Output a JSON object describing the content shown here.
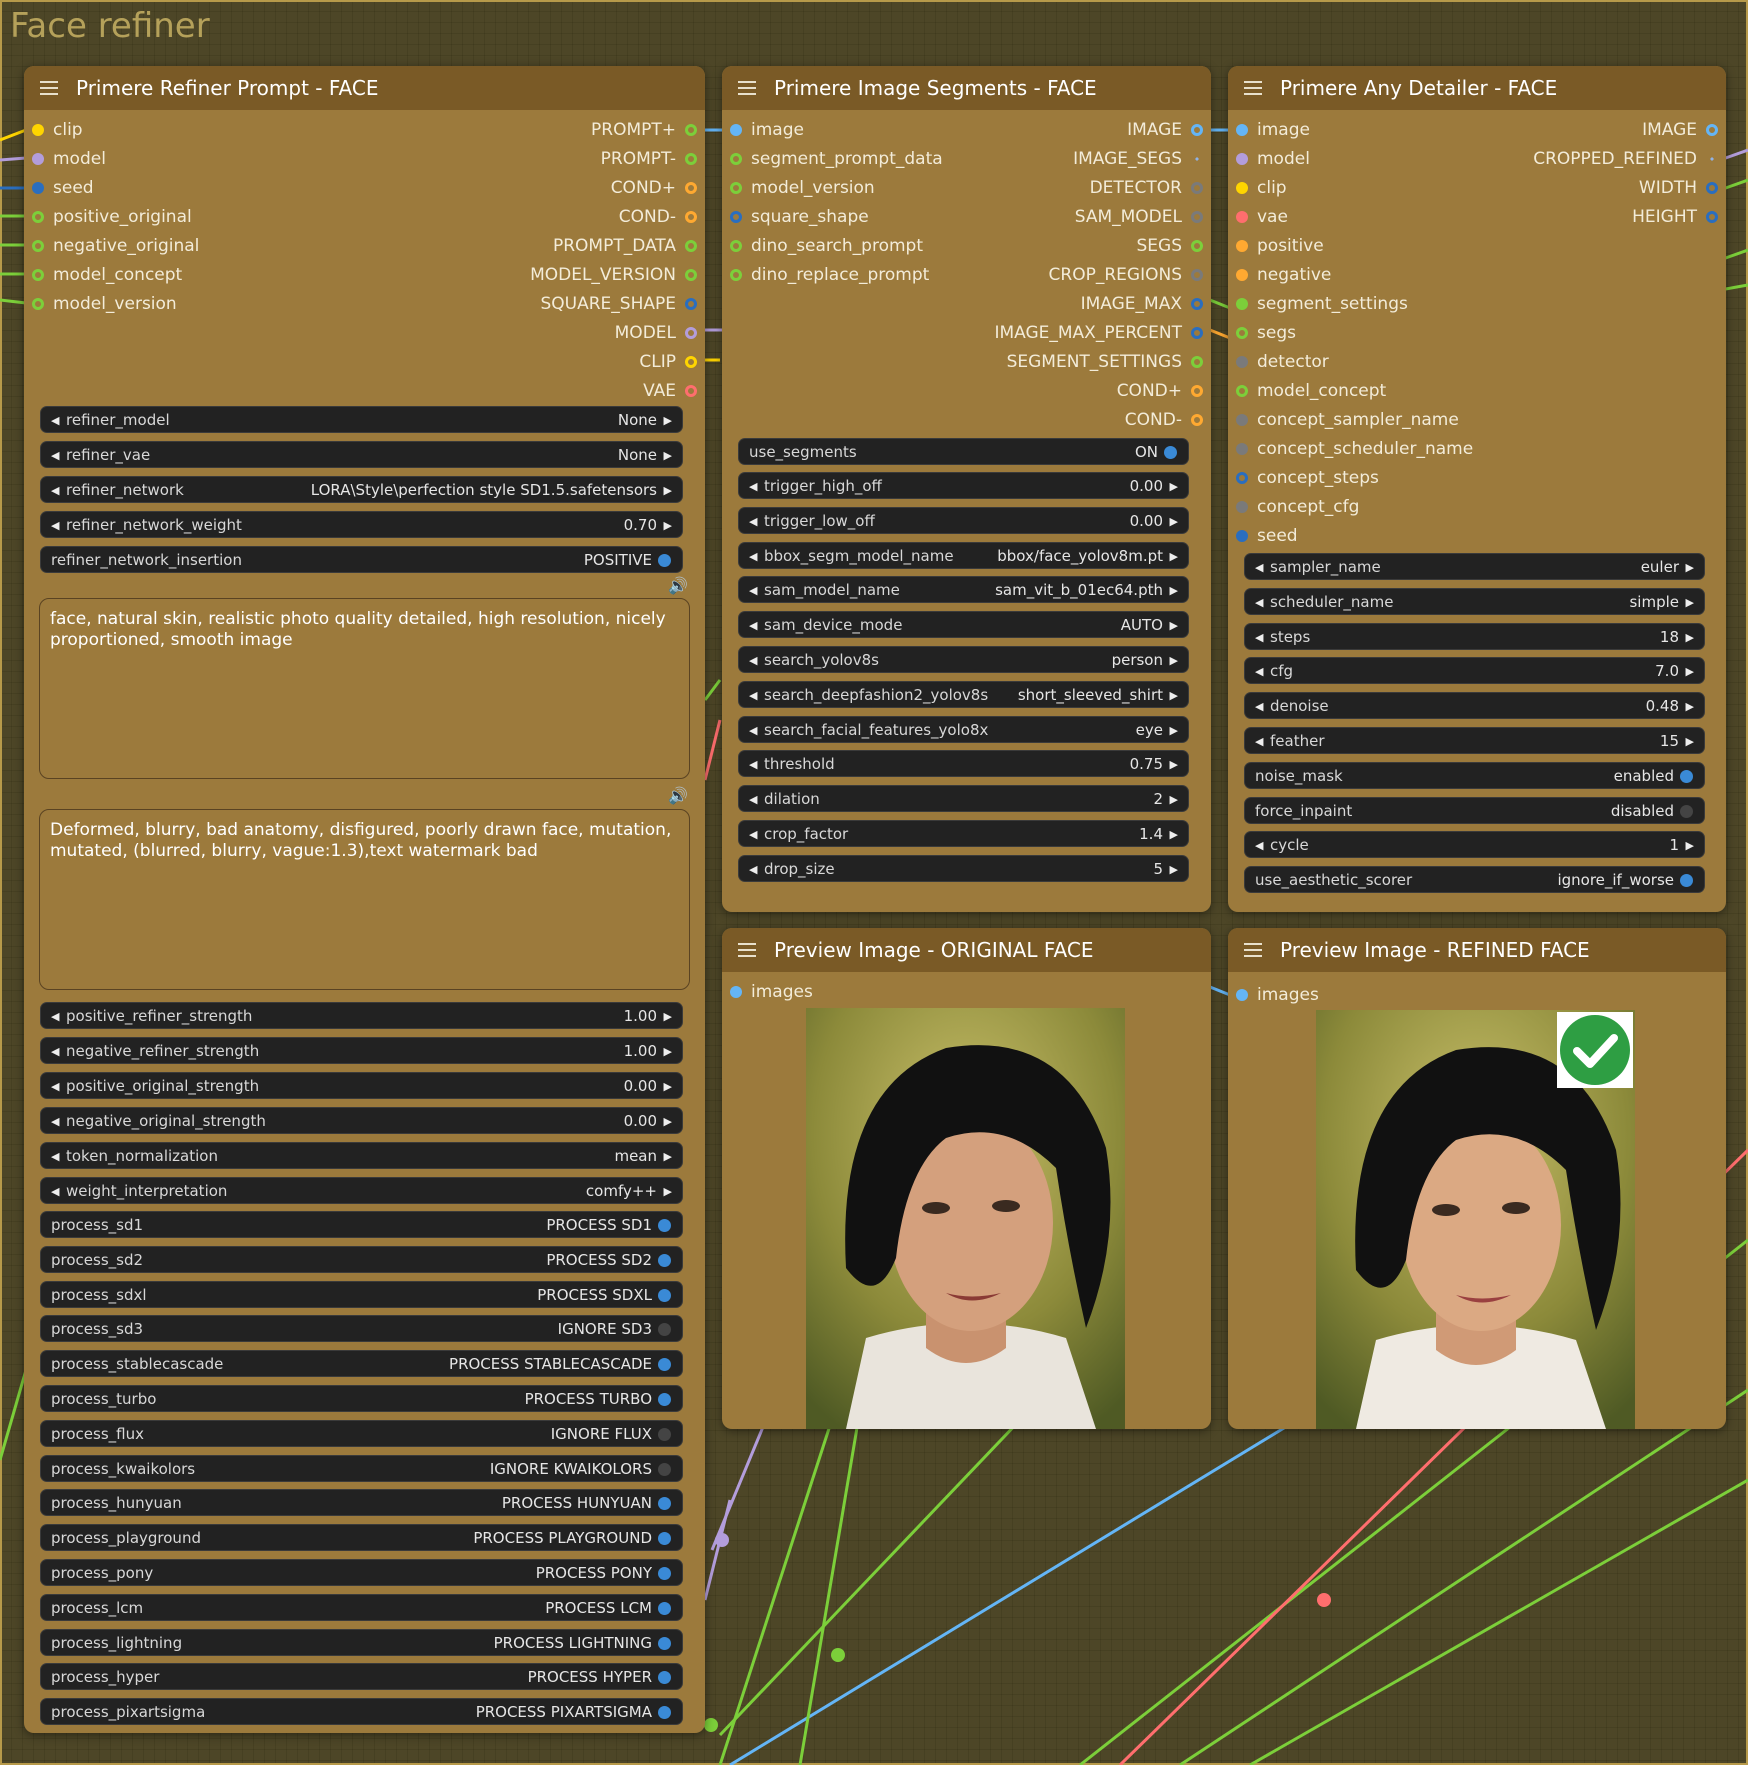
{
  "group_title": "Face refiner",
  "colors": {
    "node_bg": "#9c7a3c",
    "node_header": "#7a5a26",
    "widget_bg": "#222222",
    "toggle_on": "#3a8ad6",
    "toggle_off": "#444444",
    "clip": "#ffd500",
    "model": "#b39ddb",
    "seed": "#2a6ebf",
    "vae": "#ff6e6e",
    "cond": "#ffa931",
    "image": "#64b5f6",
    "green": "#7ccf3a",
    "gray": "#7a7a7a"
  },
  "refiner": {
    "title": "Primere Refiner Prompt - FACE",
    "inputs": [
      "clip",
      "model",
      "seed",
      "positive_original",
      "negative_original",
      "model_concept",
      "model_version"
    ],
    "outputs": [
      "PROMPT+",
      "PROMPT-",
      "COND+",
      "COND-",
      "PROMPT_DATA",
      "MODEL_VERSION",
      "SQUARE_SHAPE",
      "MODEL",
      "CLIP",
      "VAE"
    ],
    "widgets_top": [
      {
        "label": "refiner_model",
        "value": "None"
      },
      {
        "label": "refiner_vae",
        "value": "None"
      },
      {
        "label": "refiner_network",
        "value": "LORA\\Style\\perfection style SD1.5.safetensors"
      },
      {
        "label": "refiner_network_weight",
        "value": "0.70"
      }
    ],
    "insertion": {
      "label": "refiner_network_insertion",
      "value": "POSITIVE"
    },
    "positive_text": "face, natural skin, realistic photo quality detailed, high resolution, nicely proportioned, smooth image",
    "negative_text": "Deformed, blurry, bad anatomy, disfigured, poorly drawn face, mutation, mutated, (blurred, blurry, vague:1.3),text watermark bad",
    "widgets_mid": [
      {
        "label": "positive_refiner_strength",
        "value": "1.00"
      },
      {
        "label": "negative_refiner_strength",
        "value": "1.00"
      },
      {
        "label": "positive_original_strength",
        "value": "0.00"
      },
      {
        "label": "negative_original_strength",
        "value": "0.00"
      },
      {
        "label": "token_normalization",
        "value": "mean"
      },
      {
        "label": "weight_interpretation",
        "value": "comfy++"
      }
    ],
    "toggles": [
      {
        "label": "process_sd1",
        "value": "PROCESS SD1",
        "on": true
      },
      {
        "label": "process_sd2",
        "value": "PROCESS SD2",
        "on": true
      },
      {
        "label": "process_sdxl",
        "value": "PROCESS SDXL",
        "on": true
      },
      {
        "label": "process_sd3",
        "value": "IGNORE SD3",
        "on": false
      },
      {
        "label": "process_stablecascade",
        "value": "PROCESS STABLECASCADE",
        "on": true
      },
      {
        "label": "process_turbo",
        "value": "PROCESS TURBO",
        "on": true
      },
      {
        "label": "process_flux",
        "value": "IGNORE FLUX",
        "on": false
      },
      {
        "label": "process_kwaikolors",
        "value": "IGNORE KWAIKOLORS",
        "on": false
      },
      {
        "label": "process_hunyuan",
        "value": "PROCESS HUNYUAN",
        "on": true
      },
      {
        "label": "process_playground",
        "value": "PROCESS PLAYGROUND",
        "on": true
      },
      {
        "label": "process_pony",
        "value": "PROCESS PONY",
        "on": true
      },
      {
        "label": "process_lcm",
        "value": "PROCESS LCM",
        "on": true
      },
      {
        "label": "process_lightning",
        "value": "PROCESS LIGHTNING",
        "on": true
      },
      {
        "label": "process_hyper",
        "value": "PROCESS HYPER",
        "on": true
      },
      {
        "label": "process_pixartsigma",
        "value": "PROCESS PIXARTSIGMA",
        "on": true
      }
    ]
  },
  "segments": {
    "title": "Primere Image Segments - FACE",
    "inputs": [
      "image",
      "segment_prompt_data",
      "model_version",
      "square_shape",
      "dino_search_prompt",
      "dino_replace_prompt"
    ],
    "outputs": [
      "IMAGE",
      "IMAGE_SEGS",
      "DETECTOR",
      "SAM_MODEL",
      "SEGS",
      "CROP_REGIONS",
      "IMAGE_MAX",
      "IMAGE_MAX_PERCENT",
      "SEGMENT_SETTINGS",
      "COND+",
      "COND-"
    ],
    "use_segments": {
      "label": "use_segments",
      "value": "ON"
    },
    "widgets": [
      {
        "label": "trigger_high_off",
        "value": "0.00"
      },
      {
        "label": "trigger_low_off",
        "value": "0.00"
      },
      {
        "label": "bbox_segm_model_name",
        "value": "bbox/face_yolov8m.pt"
      },
      {
        "label": "sam_model_name",
        "value": "sam_vit_b_01ec64.pth"
      },
      {
        "label": "sam_device_mode",
        "value": "AUTO"
      },
      {
        "label": "search_yolov8s",
        "value": "person"
      },
      {
        "label": "search_deepfashion2_yolov8s",
        "value": "short_sleeved_shirt"
      },
      {
        "label": "search_facial_features_yolo8x",
        "value": "eye"
      },
      {
        "label": "threshold",
        "value": "0.75"
      },
      {
        "label": "dilation",
        "value": "2"
      },
      {
        "label": "crop_factor",
        "value": "1.4"
      },
      {
        "label": "drop_size",
        "value": "5"
      }
    ]
  },
  "detailer": {
    "title": "Primere Any Detailer - FACE",
    "inputs": [
      "image",
      "model",
      "clip",
      "vae",
      "positive",
      "negative",
      "segment_settings",
      "segs",
      "detector",
      "model_concept",
      "concept_sampler_name",
      "concept_scheduler_name",
      "concept_steps",
      "concept_cfg",
      "seed"
    ],
    "outputs": [
      "IMAGE",
      "CROPPED_REFINED",
      "WIDTH",
      "HEIGHT"
    ],
    "widgets": [
      {
        "label": "sampler_name",
        "value": "euler"
      },
      {
        "label": "scheduler_name",
        "value": "simple"
      },
      {
        "label": "steps",
        "value": "18"
      },
      {
        "label": "cfg",
        "value": "7.0"
      },
      {
        "label": "denoise",
        "value": "0.48"
      },
      {
        "label": "feather",
        "value": "15"
      }
    ],
    "toggles": [
      {
        "label": "noise_mask",
        "value": "enabled",
        "on": true
      },
      {
        "label": "force_inpaint",
        "value": "disabled",
        "on": false
      }
    ],
    "cycle": {
      "label": "cycle",
      "value": "1"
    },
    "aesthetic": {
      "label": "use_aesthetic_scorer",
      "value": "ignore_if_worse",
      "on": true
    }
  },
  "preview_original": {
    "title": "Preview Image - ORIGINAL FACE",
    "input": "images"
  },
  "preview_refined": {
    "title": "Preview Image - REFINED FACE",
    "input": "images"
  }
}
